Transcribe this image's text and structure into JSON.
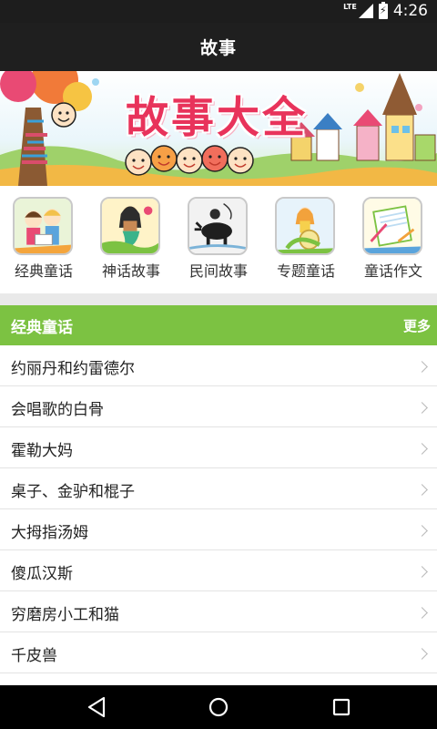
{
  "status_bar": {
    "network": "LTE",
    "time": "4:26"
  },
  "app_bar": {
    "title": "故事"
  },
  "banner": {
    "title": "故事大全"
  },
  "categories": [
    {
      "label": "经典童话",
      "icon": "kids-reading-icon"
    },
    {
      "label": "神话故事",
      "icon": "mermaid-icon"
    },
    {
      "label": "民间故事",
      "icon": "ox-herder-icon"
    },
    {
      "label": "专题童话",
      "icon": "girl-on-snail-icon"
    },
    {
      "label": "童话作文",
      "icon": "notebook-drawing-icon"
    }
  ],
  "section": {
    "title": "经典童话",
    "more": "更多",
    "color": "#7cc242"
  },
  "stories": [
    {
      "title": "约丽丹和约雷德尔"
    },
    {
      "title": "会唱歌的白骨"
    },
    {
      "title": "霍勒大妈"
    },
    {
      "title": "桌子、金驴和棍子"
    },
    {
      "title": "大拇指汤姆"
    },
    {
      "title": "傻瓜汉斯"
    },
    {
      "title": "穷磨房小工和猫"
    },
    {
      "title": "千皮兽"
    }
  ],
  "nav_bar": {
    "buttons": [
      "back",
      "home",
      "recents"
    ]
  }
}
